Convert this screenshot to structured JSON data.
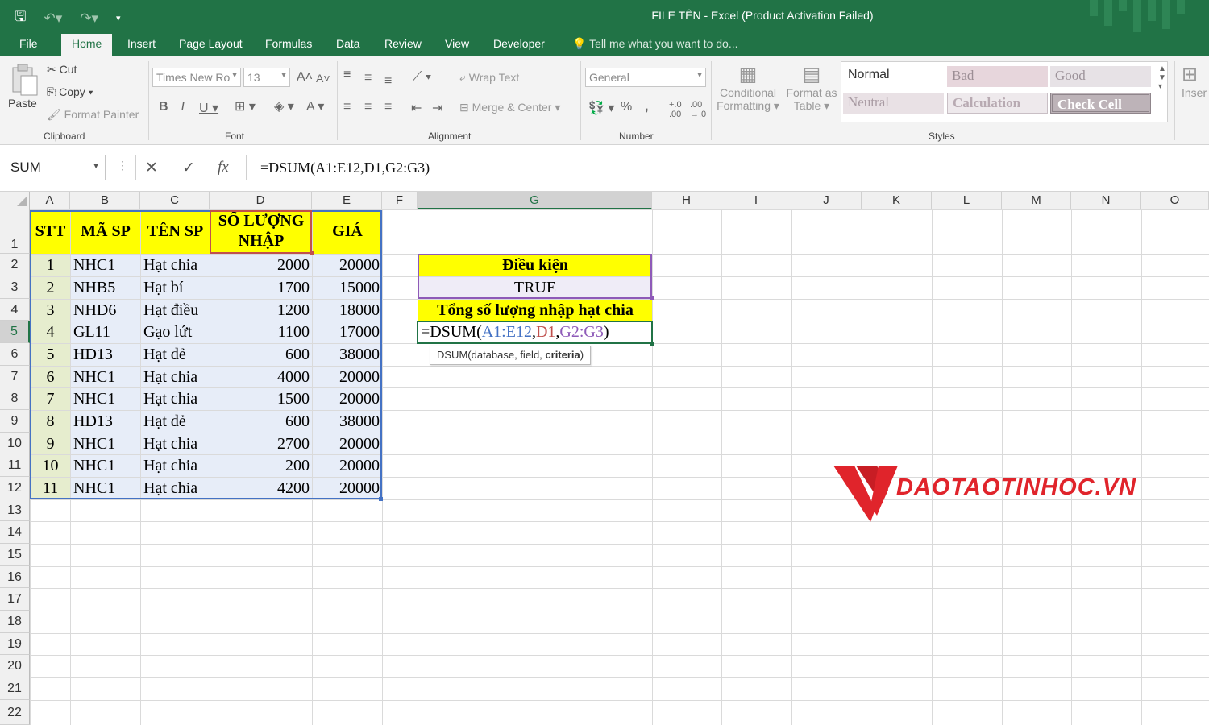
{
  "window": {
    "title": "FILE TÊN - Excel (Product Activation Failed)"
  },
  "tabs": [
    {
      "label": "File"
    },
    {
      "label": "Home"
    },
    {
      "label": "Insert"
    },
    {
      "label": "Page Layout"
    },
    {
      "label": "Formulas"
    },
    {
      "label": "Data"
    },
    {
      "label": "Review"
    },
    {
      "label": "View"
    },
    {
      "label": "Developer"
    }
  ],
  "tell_me": "Tell me what you want to do...",
  "ribbon": {
    "clipboard": {
      "paste": "Paste",
      "cut": "Cut",
      "copy": "Copy",
      "format_painter": "Format Painter",
      "label": "Clipboard"
    },
    "font": {
      "name": "Times New Ro",
      "size": "13",
      "label": "Font"
    },
    "alignment": {
      "wrap": "Wrap Text",
      "merge": "Merge & Center",
      "label": "Alignment"
    },
    "number": {
      "format": "General",
      "label": "Number"
    },
    "styles": {
      "conditional_1": "Conditional",
      "conditional_2": "Formatting",
      "format_as_1": "Format as",
      "format_as_2": "Table",
      "normal": "Normal",
      "bad": "Bad",
      "good": "Good",
      "neutral": "Neutral",
      "calculation": "Calculation",
      "check_cell": "Check Cell",
      "label": "Styles"
    },
    "insert": "Inser"
  },
  "formula_bar": {
    "name_box": "SUM",
    "formula": "=DSUM(A1:E12,D1,G2:G3)"
  },
  "columns": [
    "A",
    "B",
    "C",
    "D",
    "E",
    "F",
    "G",
    "H",
    "I",
    "J",
    "K",
    "L",
    "M",
    "N",
    "O"
  ],
  "rows": [
    "1",
    "2",
    "3",
    "4",
    "5",
    "6",
    "7",
    "8",
    "9",
    "10",
    "11",
    "12",
    "13",
    "14",
    "15",
    "16",
    "17",
    "18",
    "19",
    "20",
    "21",
    "22"
  ],
  "table": {
    "headers": [
      "STT",
      "MÃ SP",
      "TÊN SP",
      "SỐ LƯỢNG NHẬP",
      "GIÁ"
    ],
    "rows": [
      [
        "1",
        "NHC1",
        "Hạt chia",
        "2000",
        "20000"
      ],
      [
        "2",
        "NHB5",
        "Hạt bí",
        "1700",
        "15000"
      ],
      [
        "3",
        "NHD6",
        "Hạt điều",
        "1200",
        "18000"
      ],
      [
        "4",
        "GL11",
        "Gạo lứt",
        "1100",
        "17000"
      ],
      [
        "5",
        "HD13",
        "Hạt dẻ",
        "600",
        "38000"
      ],
      [
        "6",
        "NHC1",
        "Hạt chia",
        "4000",
        "20000"
      ],
      [
        "7",
        "NHC1",
        "Hạt chia",
        "1500",
        "20000"
      ],
      [
        "8",
        "HD13",
        "Hạt dẻ",
        "600",
        "38000"
      ],
      [
        "9",
        "NHC1",
        "Hạt chia",
        "2700",
        "20000"
      ],
      [
        "10",
        "NHC1",
        "Hạt chia",
        "200",
        "20000"
      ],
      [
        "11",
        "NHC1",
        "Hạt chia",
        "4200",
        "20000"
      ]
    ]
  },
  "criteria": {
    "title": "Điều kiện",
    "value": "TRUE",
    "result_label": "Tổng số lượng nhập hạt chia",
    "editing": {
      "prefix": "=DSUM(",
      "arg1": "A1:E12",
      "comma1": ",",
      "arg2": "D1",
      "comma2": ",",
      "arg3": "G2:G3",
      "suffix": ")"
    }
  },
  "tooltip": {
    "text": "DSUM(database, field, ",
    "bold": "criteria",
    "end": ")"
  },
  "logo": {
    "text": "DAOTAOTINHOC.VN"
  },
  "colors": {
    "excel_green": "#217346",
    "header_yellow": "#ffff00",
    "range_blue": "#4472c4",
    "range_red": "#c0504d",
    "range_purple": "#8e5ab8",
    "logo_red": "#e0242b"
  }
}
